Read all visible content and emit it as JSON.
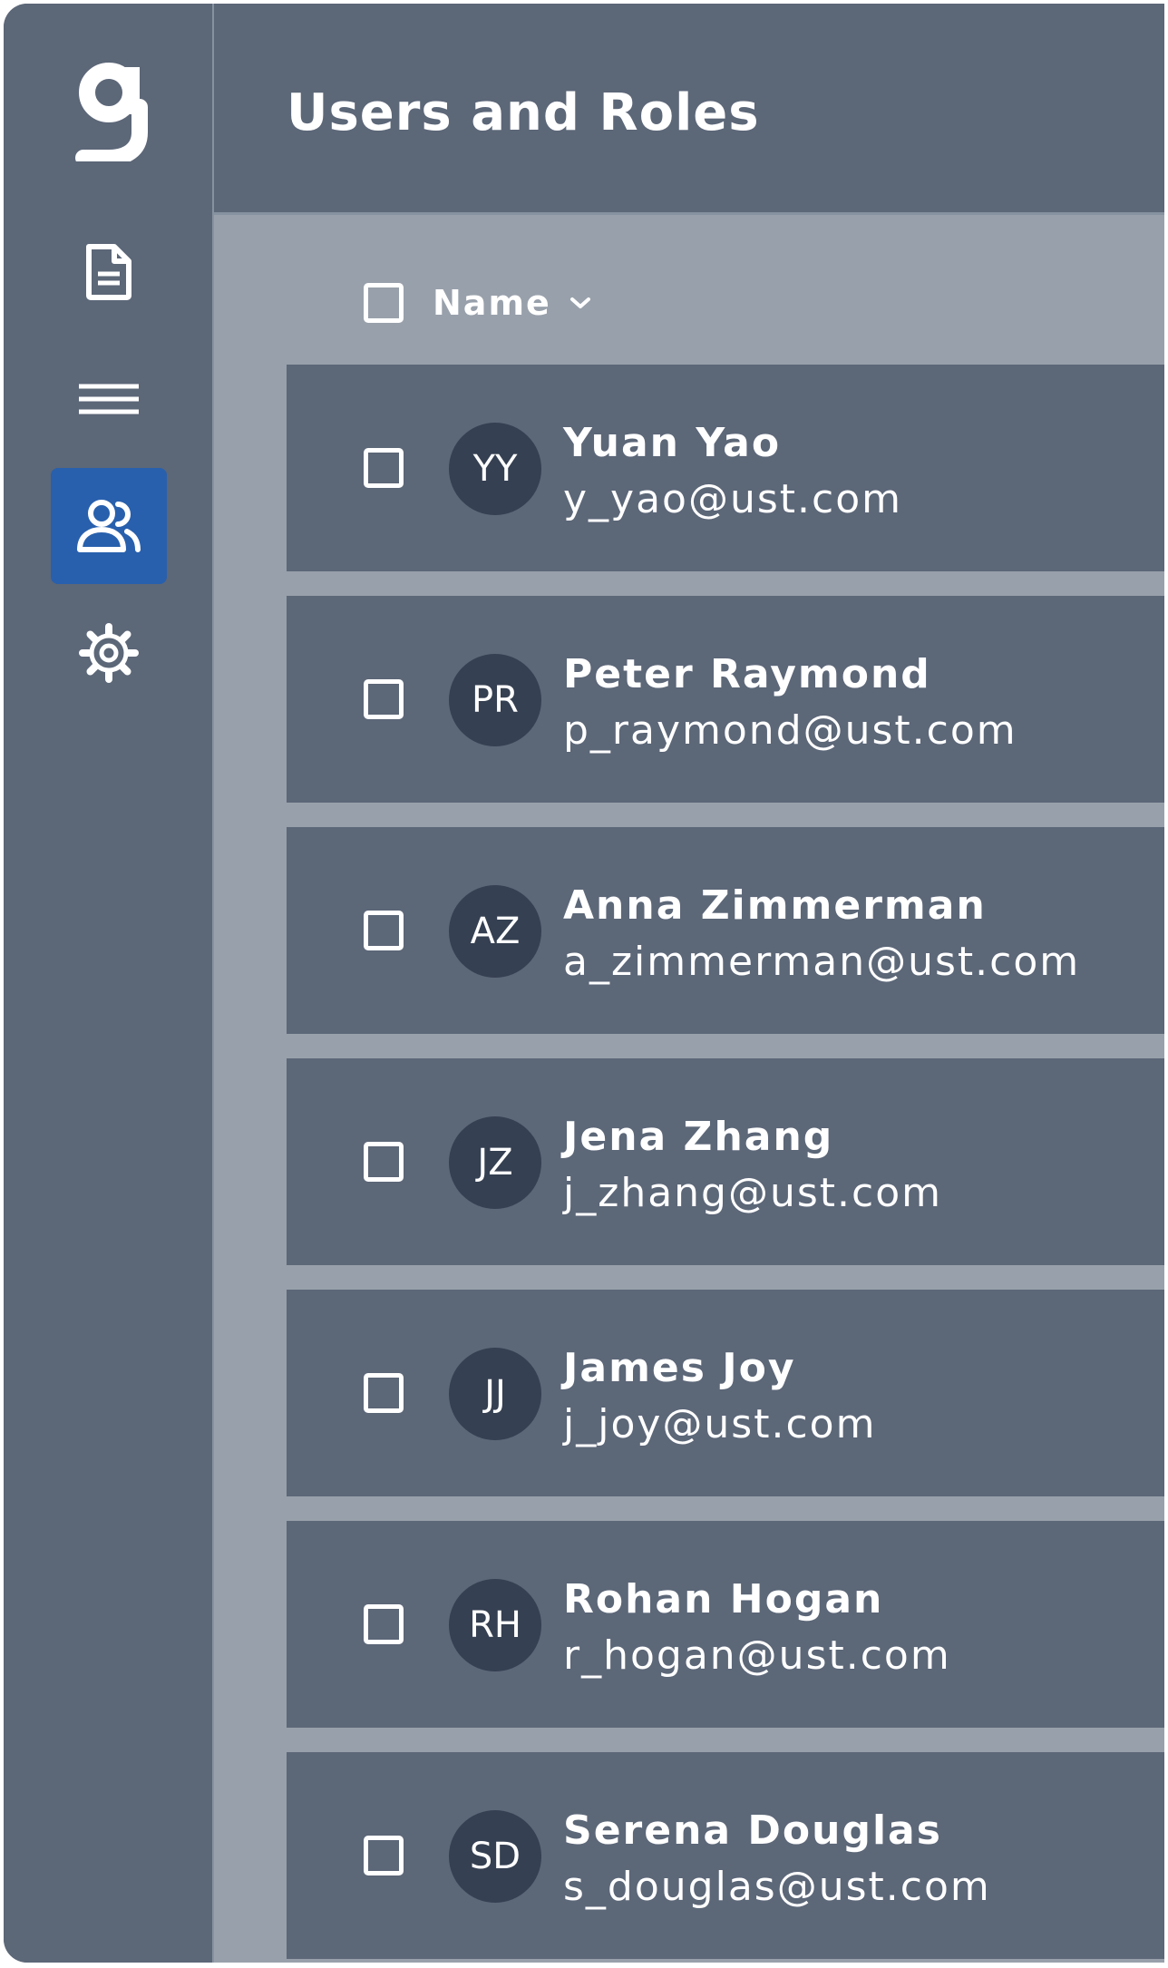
{
  "app": {
    "logo_letter": "g"
  },
  "sidebar": {
    "items": [
      {
        "name": "document",
        "icon": "document-icon",
        "active": false
      },
      {
        "name": "menu",
        "icon": "menu-lines-icon",
        "active": false
      },
      {
        "name": "users",
        "icon": "users-icon",
        "active": true
      },
      {
        "name": "settings",
        "icon": "gear-icon",
        "active": false
      }
    ],
    "active_color": "#2860ad"
  },
  "header": {
    "title": "Users and Roles"
  },
  "list": {
    "column_label": "Name",
    "sort_icon": "chevron-down-icon",
    "users": [
      {
        "initials": "YY",
        "name": "Yuan Yao",
        "email": "y_yao@ust.com"
      },
      {
        "initials": "PR",
        "name": "Peter Raymond",
        "email": "p_raymond@ust.com"
      },
      {
        "initials": "AZ",
        "name": "Anna Zimmerman",
        "email": "a_zimmerman@ust.com"
      },
      {
        "initials": "JZ",
        "name": "Jena Zhang",
        "email": "j_zhang@ust.com"
      },
      {
        "initials": "JJ",
        "name": "James Joy",
        "email": "j_joy@ust.com"
      },
      {
        "initials": "RH",
        "name": "Rohan Hogan",
        "email": "r_hogan@ust.com"
      },
      {
        "initials": "SD",
        "name": "Serena Douglas",
        "email": "s_douglas@ust.com"
      }
    ]
  },
  "colors": {
    "panel": "#5c6778",
    "content_bg": "#98a0ab",
    "avatar_bg": "#354052",
    "text": "#ffffff"
  }
}
